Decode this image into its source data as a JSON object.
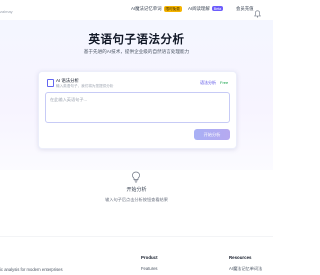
{
  "nav": {
    "brand_sub": "zalmay",
    "items": [
      {
        "label": "AI魔法记忆单词",
        "badge": "限时免费"
      },
      {
        "label": "AI阅读理解",
        "badge": "Beta"
      },
      {
        "label": "会员充值"
      }
    ],
    "colors": {
      "badge_amber": "#f5b400",
      "badge_indigo": "#6d5dfc"
    },
    "bell_icon": "bell-icon"
  },
  "hero": {
    "title": "英语句子语法分析",
    "subtitle": "基于先进的AI技术，提供企业级的自然语言处理能力"
  },
  "card": {
    "title": "AI 语法分析",
    "description": "输入英语句子，我们将为您提供分析",
    "tab_primary": "语法分析",
    "tab_secondary": "Free",
    "textarea_placeholder": "在此输入英语句子...",
    "analyze_button": "开始分析"
  },
  "empty_state": {
    "title": "开始分析",
    "description": "输入句子后点击分析按钮查看结果"
  },
  "footer": {
    "tagline": "ic analysis for modern enterprises",
    "product_heading": "Product",
    "product_link": "Features",
    "resources_heading": "Resources",
    "resources_link": "AI魔法记忆单词法"
  },
  "colors": {
    "accent": "#6366f1",
    "button_gradient_start": "#a8b0f5",
    "button_gradient_end": "#b6a9f0"
  }
}
